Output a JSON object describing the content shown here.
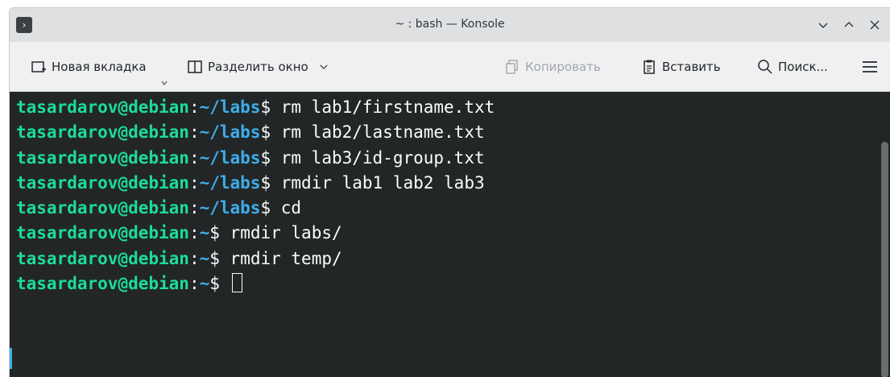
{
  "window": {
    "title": "~ : bash — Konsole"
  },
  "toolbar": {
    "new_tab": "Новая вкладка",
    "split_view": "Разделить окно",
    "copy": "Копировать",
    "paste": "Вставить",
    "search": "Поиск..."
  },
  "terminal": {
    "lines": [
      {
        "user": "tasardarov@debian",
        "colon": ":",
        "path": "~/labs",
        "prompt": "$ ",
        "cmd": "rm lab1/firstname.txt"
      },
      {
        "user": "tasardarov@debian",
        "colon": ":",
        "path": "~/labs",
        "prompt": "$ ",
        "cmd": "rm lab2/lastname.txt"
      },
      {
        "user": "tasardarov@debian",
        "colon": ":",
        "path": "~/labs",
        "prompt": "$ ",
        "cmd": "rm lab3/id-group.txt"
      },
      {
        "user": "tasardarov@debian",
        "colon": ":",
        "path": "~/labs",
        "prompt": "$ ",
        "cmd": "rmdir lab1 lab2 lab3"
      },
      {
        "user": "tasardarov@debian",
        "colon": ":",
        "path": "~/labs",
        "prompt": "$ ",
        "cmd": "cd"
      },
      {
        "user": "tasardarov@debian",
        "colon": ":",
        "path": "~",
        "prompt": "$ ",
        "cmd": "rmdir labs/"
      },
      {
        "user": "tasardarov@debian",
        "colon": ":",
        "path": "~",
        "prompt": "$ ",
        "cmd": "rmdir temp/"
      },
      {
        "user": "tasardarov@debian",
        "colon": ":",
        "path": "~",
        "prompt": "$ ",
        "cmd": ""
      }
    ]
  },
  "colors": {
    "user": "#1cdc9a",
    "path": "#3daee9",
    "text": "#fcfcfc",
    "background": "#232627"
  },
  "icons": {
    "app": "konsole-icon",
    "new_tab": "new-tab-icon",
    "split": "split-view-icon",
    "copy": "copy-icon",
    "paste": "paste-icon",
    "search": "search-icon",
    "menu": "hamburger-menu-icon"
  }
}
